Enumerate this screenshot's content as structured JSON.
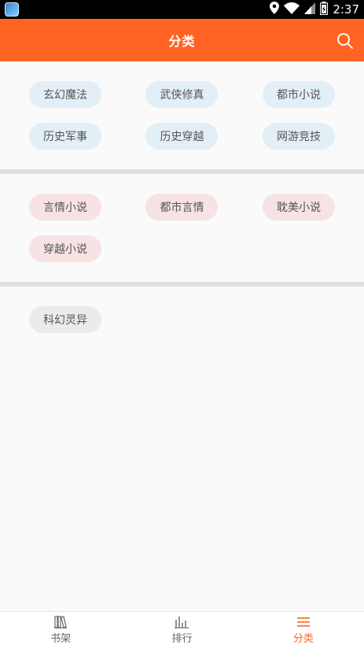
{
  "status_bar": {
    "time": "2:37"
  },
  "header": {
    "title": "分类",
    "search_icon": "search-icon"
  },
  "sections": [
    {
      "color": "blue",
      "tags": [
        "玄幻魔法",
        "武侠修真",
        "都市小说",
        "历史军事",
        "历史穿越",
        "网游竞技"
      ]
    },
    {
      "color": "pink",
      "tags": [
        "言情小说",
        "都市言情",
        "耽美小说",
        "穿越小说"
      ]
    },
    {
      "color": "gray",
      "tags": [
        "科幻灵异"
      ]
    }
  ],
  "bottom_nav": {
    "items": [
      {
        "label": "书架",
        "icon": "bookshelf-icon"
      },
      {
        "label": "排行",
        "icon": "ranking-icon"
      },
      {
        "label": "分类",
        "icon": "category-icon",
        "active": true
      }
    ]
  },
  "colors": {
    "accent": "#ff6424",
    "tag_blue": "#e3eff6",
    "tag_pink": "#f7e2e4",
    "tag_gray": "#ebebeb"
  }
}
